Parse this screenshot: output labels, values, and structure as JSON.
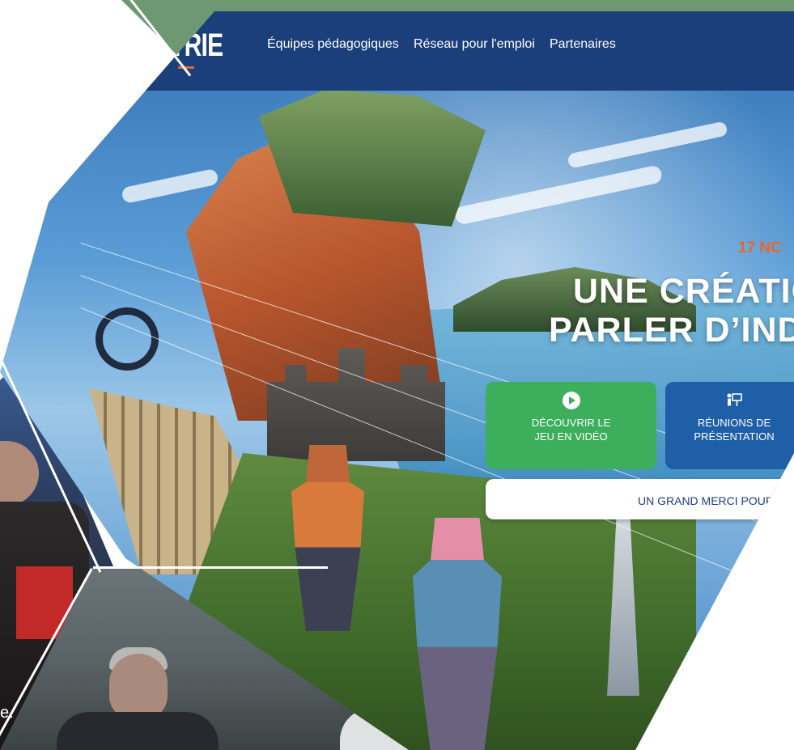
{
  "nav": {
    "logo_text": "TRIE",
    "links": [
      "Équipes pédagogiques",
      "Réseau pour l'emploi",
      "Partenaires"
    ]
  },
  "hero": {
    "date": "17 NC",
    "title_line1": "UNE CRÉATIO",
    "title_line2": "PARLER D’INDU"
  },
  "buttons": {
    "video_line1": "DÉCOUVRIR LE",
    "video_line2": "JEU EN VIDÉO",
    "reunion_line1": "RÉUNIONS DE",
    "reunion_line2": "PRÉSENTATION"
  },
  "merci_text": "UN GRAND MERCI POUR V",
  "photo_caption": "e.",
  "colors": {
    "navbar": "#1b3f7a",
    "accent_orange": "#e8672a",
    "button_green": "#3cae5c",
    "button_blue": "#1f5fa7",
    "background_green": "#6e9872"
  },
  "icons": {
    "video": "play-circle-icon",
    "reunion": "presentation-icon"
  }
}
